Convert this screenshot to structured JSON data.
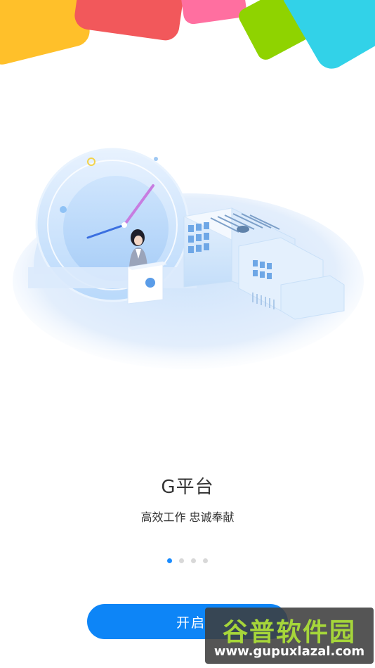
{
  "intro": {
    "title": "G平台",
    "subtitle": "高效工作 忠诚奉献",
    "pager": {
      "total": 4,
      "active": 1
    }
  },
  "start_button": {
    "label": "开启"
  },
  "watermark": {
    "text": "谷普软件园",
    "url": "www.gupuxlazal.com"
  },
  "colors": {
    "accent": "#0d85f7",
    "tiles": [
      "#ffc02a",
      "#f2585b",
      "#ff6fa0",
      "#8fd300",
      "#32d2e8"
    ]
  }
}
